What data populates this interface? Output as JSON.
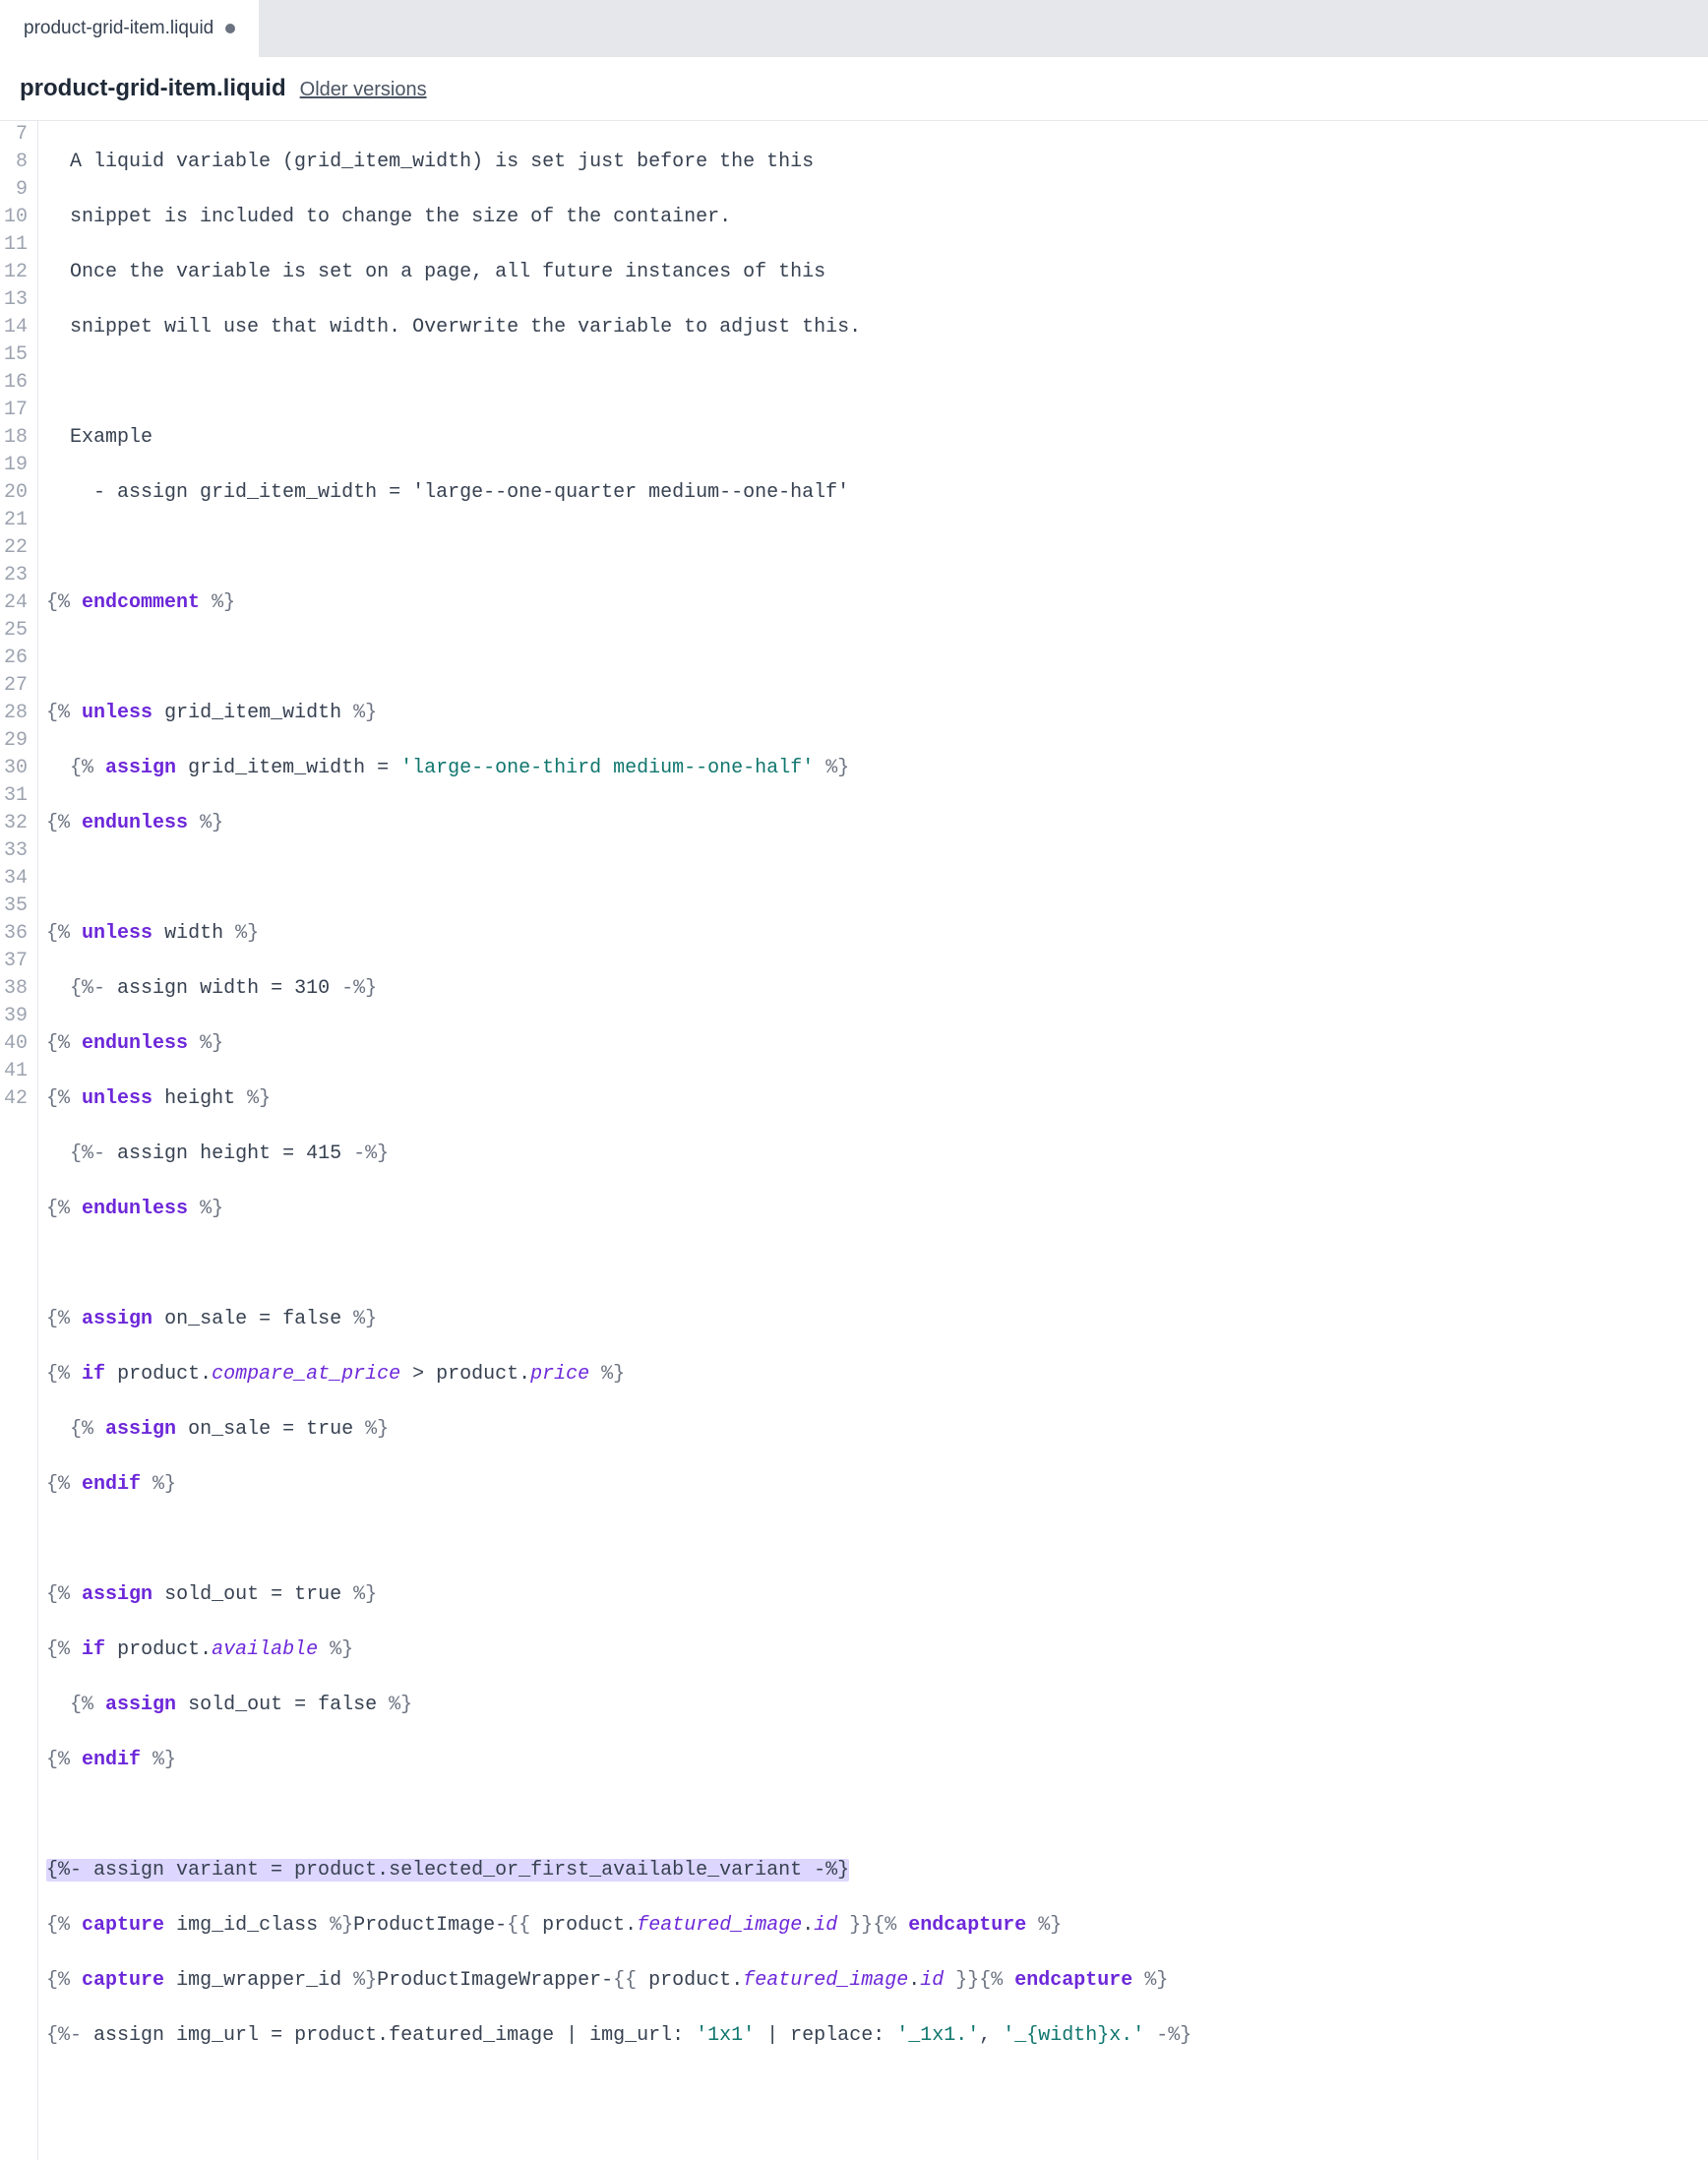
{
  "tab": {
    "label": "product-grid-item.liquid",
    "modified": true
  },
  "header": {
    "filename": "product-grid-item.liquid",
    "older_versions": "Older versions"
  },
  "line_start": 7,
  "line_end": 42,
  "code": {
    "l7": "  A liquid variable (grid_item_width) is set just before the this",
    "l8": "  snippet is included to change the size of the container.",
    "l9": "  Once the variable is set on a page, all future instances of this",
    "l10": "  snippet will use that width. Overwrite the variable to adjust this.",
    "l12": "  Example",
    "l13": "    - assign grid_item_width = 'large--one-quarter medium--one-half'",
    "l15_kw": "endcomment",
    "l17_kw": "unless",
    "l17_var": "grid_item_width",
    "l18_kw": "assign",
    "l18_var": "grid_item_width",
    "l18_str": "'large--one-third medium--one-half'",
    "l19_kw": "endunless",
    "l21_kw": "unless",
    "l21_var": "width",
    "l22_var": "width",
    "l22_num": "310",
    "l23_kw": "endunless",
    "l24_kw": "unless",
    "l24_var": "height",
    "l25_var": "height",
    "l25_num": "415",
    "l26_kw": "endunless",
    "l28_kw": "assign",
    "l28_var": "on_sale",
    "l28_val": "false",
    "l29_kw": "if",
    "l29_obj": "product",
    "l29_p1": "compare_at_price",
    "l29_p2": "price",
    "l30_kw": "assign",
    "l30_var": "on_sale",
    "l30_val": "true",
    "l31_kw": "endif",
    "l33_kw": "assign",
    "l33_var": "sold_out",
    "l33_val": "true",
    "l34_kw": "if",
    "l34_obj": "product",
    "l34_p1": "available",
    "l35_kw": "assign",
    "l35_var": "sold_out",
    "l35_val": "false",
    "l36_kw": "endif",
    "l38": "{%- assign variant = product.selected_or_first_available_variant -%}",
    "l39_kw1": "capture",
    "l39_var": "img_id_class",
    "l39_txt": "ProductImage-",
    "l39_obj": "product",
    "l39_p1": "featured_image",
    "l39_p2": "id",
    "l39_kw2": "endcapture",
    "l40_kw1": "capture",
    "l40_var": "img_wrapper_id",
    "l40_txt": "ProductImageWrapper-",
    "l40_obj": "product",
    "l40_p1": "featured_image",
    "l40_p2": "id",
    "l40_kw2": "endcapture",
    "l41_var": "img_url",
    "l41_rhs": "product.featured_image | img_url: ",
    "l41_s1": "'1x1'",
    "l41_mid": " | replace: ",
    "l41_s2": "'_1x1.'",
    "l41_s3": "'_{width}x.'"
  }
}
